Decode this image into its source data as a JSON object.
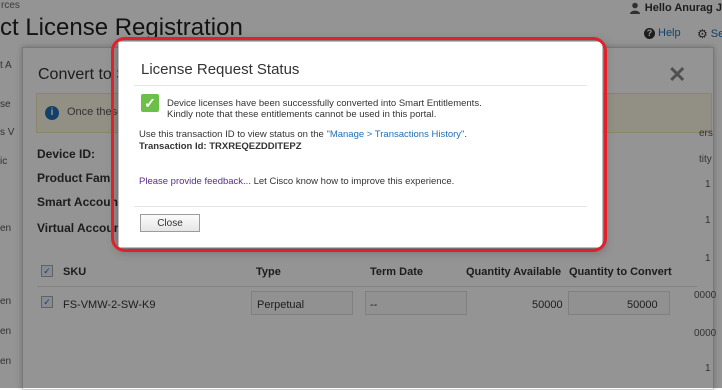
{
  "page": {
    "crumb": "rces",
    "title": "ct License Registration",
    "user_greeting": "Hello Anurag J",
    "help_label": "Help",
    "settings_label": "Setti",
    "left_edge": [
      "t A",
      "se",
      "s V",
      "ic",
      "en",
      "en",
      "en",
      "en"
    ]
  },
  "under_modal": {
    "title": "Convert to S",
    "info_text": "Once these",
    "fields": [
      "Device ID:",
      "Product Fami",
      "Smart Accoun",
      "Virtual Accoun"
    ],
    "right_col": [
      "ers",
      "tity",
      "1",
      "1",
      "1",
      "0000",
      "0000",
      "1"
    ],
    "table": {
      "headers": [
        "SKU",
        "Type",
        "Term Date",
        "Quantity Available",
        "Quantity to Convert"
      ],
      "rows": [
        {
          "sku": "FS-VMW-2-SW-K9",
          "type": "Perpetual",
          "term": "--",
          "qty_available": "50000",
          "qty_convert": "50000"
        }
      ]
    }
  },
  "dialog": {
    "title": "License Request Status",
    "success_line1": "Device licenses have been successfully converted into Smart Entitlements.",
    "success_line2": "Kindly note that these entitlements cannot be used in this portal.",
    "txn_prefix": "Use this transaction ID to view status on the ",
    "txn_link": "\"Manage > Transactions History\"",
    "txn_suffix": ".",
    "txn_id_label": "Transaction Id: TRXREQEZDDITEPZ",
    "feedback_link": "Please provide feedback...",
    "feedback_text": " Let Cisco know how to improve this experience.",
    "close_label": "Close"
  },
  "colors": {
    "highlight": "#e0212b",
    "success": "#6cc04a",
    "link": "#1f6fb6"
  }
}
